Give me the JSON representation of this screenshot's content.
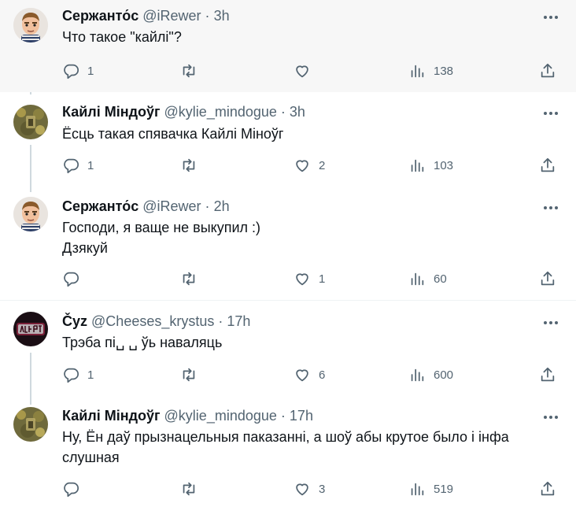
{
  "tweets": [
    {
      "name": "Сержанто́с",
      "handle": "@iRewer",
      "time": "3h",
      "avatar": "cartoon-face-avatar",
      "lines": [
        "Что такое \"кайлі\"?"
      ],
      "replies": "1",
      "retweets": "",
      "likes": "",
      "views": "138",
      "highlighted": true
    },
    {
      "name": "Кайлі Міндоўг",
      "handle": "@kylie_mindogue",
      "time": "3h",
      "avatar": "gold-texture-avatar",
      "lines": [
        "Ёсць такая спявачка Кайлі Міноўг"
      ],
      "replies": "1",
      "retweets": "",
      "likes": "2",
      "views": "103"
    },
    {
      "name": "Сержанто́с",
      "handle": "@iRewer",
      "time": "2h",
      "avatar": "cartoon-face-avatar",
      "lines": [
        "Господи, я ваще не выкупил :)",
        "Дзякуй"
      ],
      "replies": "",
      "retweets": "",
      "likes": "1",
      "views": "60"
    },
    {
      "name": "Čyz",
      "handle": "@Cheeses_krystus",
      "time": "17h",
      "avatar": "dark-logo-avatar",
      "lines": [
        "Трэба пі␣ ␣ ўь наваляць"
      ],
      "replies": "1",
      "retweets": "",
      "likes": "6",
      "views": "600"
    },
    {
      "name": "Кайлі Міндоўг",
      "handle": "@kylie_mindogue",
      "time": "17h",
      "avatar": "gold-texture-avatar",
      "lines": [
        "Ну, Ён даў прызнацельныя паказанні, а шоў абы крутое было і інфа",
        "слушная"
      ],
      "replies": "",
      "retweets": "",
      "likes": "3",
      "views": "519"
    }
  ],
  "separator": "·",
  "colors": {
    "text": "#0f1419",
    "secondary": "#536471",
    "thread_line": "#cfd9de",
    "highlight_bg": "#f7f7f7"
  },
  "icons": [
    "reply-icon",
    "retweet-icon",
    "like-icon",
    "views-icon",
    "share-icon",
    "more-icon"
  ]
}
